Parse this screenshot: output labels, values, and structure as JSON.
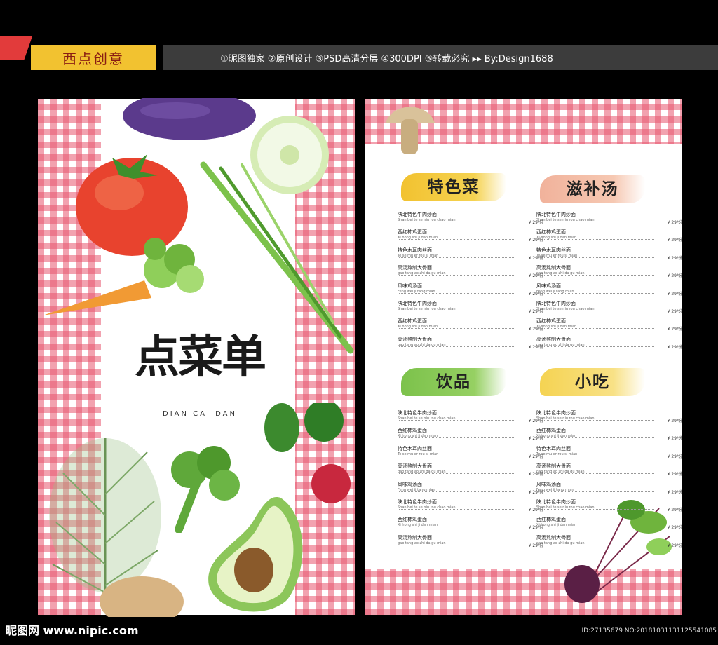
{
  "header": {
    "logo_text": "西点创意",
    "info": "①昵图独家 ②原创设计 ③PSD高清分层 ④300DPI ⑤转载必究 ▸▸ By:Design1688"
  },
  "cover": {
    "title": "点菜单",
    "subtitle": "DIAN CAI DAN"
  },
  "sections": [
    {
      "heading": "特色菜",
      "items": [
        {
          "name": "陕北特色牛肉炒面",
          "pinyin": "Shan bei te se niu rou chao mian",
          "price": "¥ 29/份"
        },
        {
          "name": "西红柿鸡蛋面",
          "pinyin": "Xi hong shi ji dan mian",
          "price": "¥ 29/份"
        },
        {
          "name": "特色木耳肉丝面",
          "pinyin": "Te se mu er rou si mian",
          "price": "¥ 29/份"
        },
        {
          "name": "高汤熬制大骨面",
          "pinyin": "gao tang ao zhi da gu mian",
          "price": "¥ 29/份"
        },
        {
          "name": "风味鸡汤面",
          "pinyin": "Feng wei ji tang mian",
          "price": "¥ 29/份"
        },
        {
          "name": "陕北特色牛肉炒面",
          "pinyin": "Shan bei te se niu rou chao mian",
          "price": "¥ 29/份"
        },
        {
          "name": "西红柿鸡蛋面",
          "pinyin": "Xi hong shi ji dan mian",
          "price": "¥ 29/份"
        },
        {
          "name": "高汤熬制大骨面",
          "pinyin": "gao tang ao zhi da gu mian",
          "price": "¥ 29/份"
        }
      ]
    },
    {
      "heading": "滋补汤",
      "items": [
        {
          "name": "陕北特色牛肉炒面",
          "pinyin": "Shan bei te se niu rou chao mian",
          "price": "¥ 29/份"
        },
        {
          "name": "西红柿鸡蛋面",
          "pinyin": "Xi hong shi ji dan mian",
          "price": "¥ 29/份"
        },
        {
          "name": "特色木耳肉丝面",
          "pinyin": "Te se mu er rou si mian",
          "price": "¥ 29/份"
        },
        {
          "name": "高汤熬制大骨面",
          "pinyin": "gao tang ao zhi da gu mian",
          "price": "¥ 29/份"
        },
        {
          "name": "风味鸡汤面",
          "pinyin": "Feng wei ji tang mian",
          "price": "¥ 29/份"
        },
        {
          "name": "陕北特色牛肉炒面",
          "pinyin": "Shan bei te se niu rou chao mian",
          "price": "¥ 29/份"
        },
        {
          "name": "西红柿鸡蛋面",
          "pinyin": "Xi hong shi ji dan mian",
          "price": "¥ 29/份"
        },
        {
          "name": "高汤熬制大骨面",
          "pinyin": "gao tang ao zhi da gu mian",
          "price": "¥ 29/份"
        }
      ]
    },
    {
      "heading": "饮品",
      "items": [
        {
          "name": "陕北特色牛肉炒面",
          "pinyin": "Shan bei te se niu rou chao mian",
          "price": "¥ 29/份"
        },
        {
          "name": "西红柿鸡蛋面",
          "pinyin": "Xi hong shi ji dan mian",
          "price": "¥ 29/份"
        },
        {
          "name": "特色木耳肉丝面",
          "pinyin": "Te se mu er rou si mian",
          "price": "¥ 29/份"
        },
        {
          "name": "高汤熬制大骨面",
          "pinyin": "gao tang ao zhi da gu mian",
          "price": "¥ 29/份"
        },
        {
          "name": "风味鸡汤面",
          "pinyin": "Feng wei ji tang mian",
          "price": "¥ 29/份"
        },
        {
          "name": "陕北特色牛肉炒面",
          "pinyin": "Shan bei te se niu rou chao mian",
          "price": "¥ 29/份"
        },
        {
          "name": "西红柿鸡蛋面",
          "pinyin": "Xi hong shi ji dan mian",
          "price": "¥ 29/份"
        },
        {
          "name": "高汤熬制大骨面",
          "pinyin": "gao tang ao zhi da gu mian",
          "price": "¥ 29/份"
        }
      ]
    },
    {
      "heading": "小吃",
      "items": [
        {
          "name": "陕北特色牛肉炒面",
          "pinyin": "Shan bei te se niu rou chao mian",
          "price": "¥ 29/份"
        },
        {
          "name": "西红柿鸡蛋面",
          "pinyin": "Xi hong shi ji dan mian",
          "price": "¥ 29/份"
        },
        {
          "name": "特色木耳肉丝面",
          "pinyin": "Te se mu er rou si mian",
          "price": "¥ 29/份"
        },
        {
          "name": "高汤熬制大骨面",
          "pinyin": "gao tang ao zhi da gu mian",
          "price": "¥ 29/份"
        },
        {
          "name": "风味鸡汤面",
          "pinyin": "Feng wei ji tang mian",
          "price": "¥ 29/份"
        },
        {
          "name": "陕北特色牛肉炒面",
          "pinyin": "Shan bei te se niu rou chao mian",
          "price": "¥ 29/份"
        },
        {
          "name": "西红柿鸡蛋面",
          "pinyin": "Xi hong shi ji dan mian",
          "price": "¥ 29/份"
        },
        {
          "name": "高汤熬制大骨面",
          "pinyin": "gao tang ao zhi da gu mian",
          "price": "¥ 29/份"
        }
      ]
    }
  ],
  "footer": {
    "watermark": "昵图网 www.nipic.com",
    "id_text": "ID:27135679 NO:20181031131125541085"
  },
  "colors": {
    "gingham": "#e8566e",
    "banner_yellow": "#f2c230",
    "banner_red": "#e23b3b",
    "header_bar": "#3c3c3c"
  },
  "icons": [
    "eggplant-icon",
    "tomato-icon",
    "cucumber-slice-icon",
    "scallion-icon",
    "carrot-icon",
    "broccoli-icon",
    "radish-icon",
    "dill-icon",
    "avocado-icon",
    "potato-icon",
    "mushroom-icon",
    "beet-icon"
  ]
}
